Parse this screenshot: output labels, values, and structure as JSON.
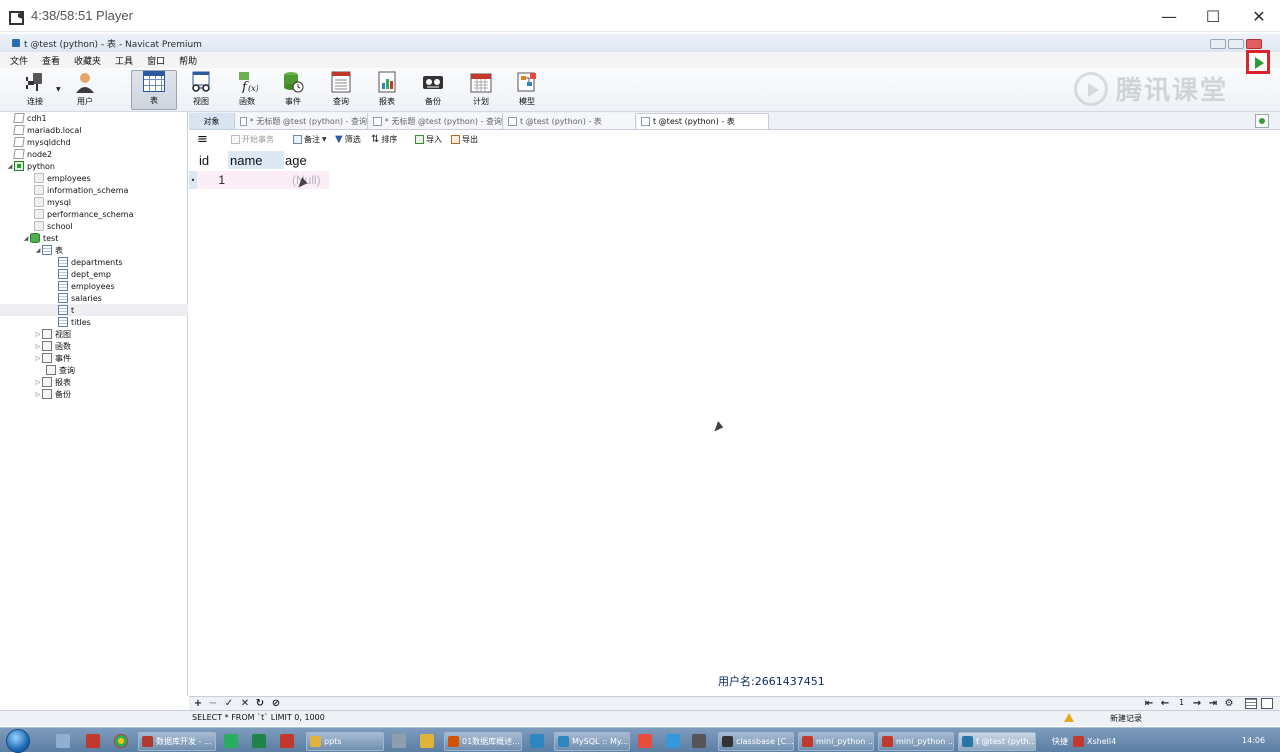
{
  "player": {
    "title": "4:38/58:51 Player",
    "minimize": "—",
    "maximize": "☐",
    "close": "✕"
  },
  "navicat": {
    "title": "t @test (python) - 表 - Navicat Premium"
  },
  "menu": [
    "文件",
    "查看",
    "收藏夹",
    "工具",
    "窗口",
    "帮助"
  ],
  "toolbar": {
    "items": [
      {
        "label": "连接",
        "icon": "plug-icon"
      },
      {
        "label": "用户",
        "icon": "user-icon"
      },
      {
        "label": "表",
        "icon": "table-icon"
      },
      {
        "label": "视图",
        "icon": "view-icon"
      },
      {
        "label": "函数",
        "icon": "function-icon"
      },
      {
        "label": "事件",
        "icon": "event-icon"
      },
      {
        "label": "查询",
        "icon": "query-icon"
      },
      {
        "label": "报表",
        "icon": "report-icon"
      },
      {
        "label": "备份",
        "icon": "backup-icon"
      },
      {
        "label": "计划",
        "icon": "schedule-icon"
      },
      {
        "label": "模型",
        "icon": "model-icon"
      }
    ],
    "active": "表"
  },
  "watermark": {
    "text": "腾讯课堂"
  },
  "tree": {
    "connections": [
      "cdh1",
      "mariadb.local",
      "mysqldchd",
      "node2",
      "python"
    ],
    "databases": [
      "employees",
      "information_schema",
      "mysql",
      "performance_schema",
      "school",
      "test"
    ],
    "tables_folder": "表",
    "tables": [
      "departments",
      "dept_emp",
      "employees",
      "salaries",
      "t",
      "titles"
    ],
    "other_nodes": [
      "视图",
      "函数",
      "事件",
      "查询",
      "报表",
      "备份"
    ]
  },
  "tabs": {
    "objects": "对象",
    "items": [
      "* 无标题 @test (python) - 查询",
      "* 无标题 @test (python) - 查询",
      "t @test (python) - 表",
      "t @test (python) - 表"
    ]
  },
  "grid_toolbar": {
    "menu": "≡",
    "begin_transaction": "开始事务",
    "memo": "备注",
    "filter": "筛选",
    "sort": "排序",
    "import": "导入",
    "export": "导出"
  },
  "grid": {
    "columns": [
      "id",
      "name",
      "age"
    ],
    "rows": [
      {
        "marker": "•",
        "id": "1",
        "name": "",
        "age": "(Null)"
      }
    ]
  },
  "username": "用户名:2661437451",
  "nav": {
    "add": "+",
    "remove": "−",
    "apply": "✓",
    "cancel": "✕",
    "refresh": "↻",
    "stop": "⊘",
    "first": "⇤",
    "prev": "←",
    "page": "1",
    "next": "→",
    "last": "⇥",
    "settings": "⚙"
  },
  "status": {
    "sql": "SELECT * FROM `t` LIMIT 0, 1000",
    "new_record": "新建记录"
  },
  "taskbar": {
    "tasks": [
      {
        "label": "数据库开发 - ...",
        "color": "#b03a2e"
      },
      {
        "label": "ppts",
        "color": "#e0b33a"
      },
      {
        "label": "01数据库概述...",
        "color": "#d35400"
      },
      {
        "label": "MySQL :: My...",
        "color": "#2e86c1"
      },
      {
        "label": "classbase [C...",
        "color": "#333333"
      },
      {
        "label": "mini_python ...",
        "color": "#c0392b"
      },
      {
        "label": "mini_python ...",
        "color": "#c0392b"
      },
      {
        "label": "t @test (pyth...",
        "color": "#2874a6"
      },
      {
        "label": "Xshell4",
        "color": "#c0392b"
      }
    ],
    "quick": "快捷",
    "clock": "14:06"
  }
}
